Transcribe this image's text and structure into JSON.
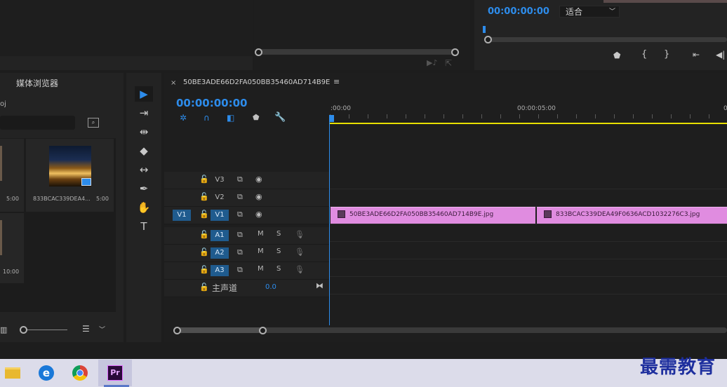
{
  "program_monitor": {
    "timecode": "00:00:00:00",
    "fit_select": "适合"
  },
  "media_browser": {
    "title": "媒体浏览器",
    "proj_label": "oj",
    "items": [
      {
        "duration": "5:00"
      },
      {
        "name": "833BCAC339DEA4...",
        "duration": "5:00"
      },
      {
        "duration": "10:00"
      }
    ]
  },
  "timeline": {
    "sequence_name": "50BE3ADE66D2FA050BB35460AD714B9E",
    "timecode": "00:00:00:00",
    "ruler": [
      ":00:00",
      "00:00:05:00",
      "0"
    ],
    "video_tracks": [
      {
        "label": "V3",
        "source": ""
      },
      {
        "label": "V2",
        "source": ""
      },
      {
        "label": "V1",
        "source": "V1"
      }
    ],
    "audio_tracks": [
      {
        "label": "A1",
        "source": "",
        "m": "M",
        "s": "S"
      },
      {
        "label": "A2",
        "source": "",
        "m": "M",
        "s": "S"
      },
      {
        "label": "A3",
        "source": "",
        "m": "M",
        "s": "S"
      }
    ],
    "master": {
      "label": "主声道",
      "value": "0.0"
    },
    "clips": [
      {
        "name": "50BE3ADE66D2FA050BB35460AD714B9E.jpg"
      },
      {
        "name": "833BCAC339DEA49F0636ACD1032276C3.jpg"
      }
    ]
  },
  "taskbar": {
    "apps": [
      "file-explorer",
      "edge",
      "chrome",
      "premiere"
    ],
    "premiere_label": "Pr"
  },
  "watermark": "最需教育",
  "colors": {
    "accent": "#2d8ceb",
    "clip": "#e08ce0",
    "playhead": "#2d8ceb",
    "work_area": "#e8e000"
  }
}
